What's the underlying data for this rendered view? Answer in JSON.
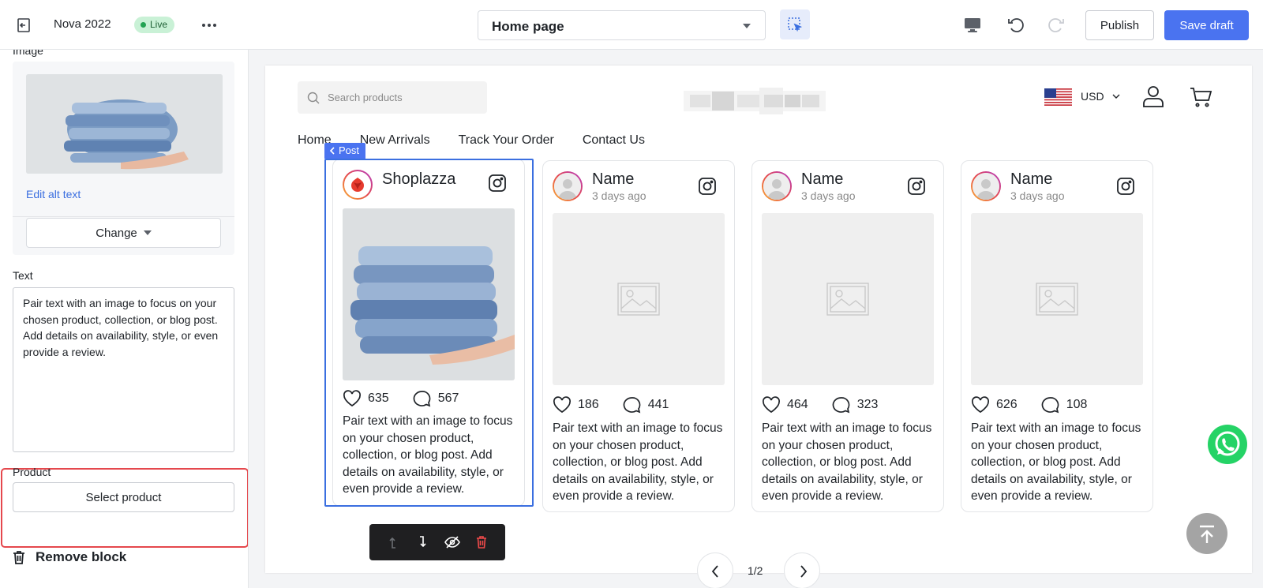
{
  "topbar": {
    "store_name": "Nova 2022",
    "status_badge": "Live",
    "page_select_value": "Home page",
    "publish_label": "Publish",
    "save_label": "Save draft"
  },
  "left_panel": {
    "image_section_label": "Image",
    "edit_alt_text": "Edit alt text",
    "change_label": "Change",
    "text_label": "Text",
    "text_value": "Pair text with an image to focus on your chosen product, collection, or blog post. Add details on availability, style, or even provide a review.",
    "product_label": "Product",
    "select_product_label": "Select product",
    "remove_block_label": "Remove block"
  },
  "storefront": {
    "search_placeholder": "Search products",
    "currency": "USD",
    "nav": [
      "Home",
      "New Arrivals",
      "Track Your Order",
      "Contact Us"
    ],
    "selected_block_tag": "Post",
    "posts": [
      {
        "name": "Shoplazza",
        "date": "",
        "likes": "635",
        "comments": "567",
        "description": "Pair text with an image to focus on your chosen product, collection, or blog post. Add details on availability, style, or even provide a review.",
        "has_image": true
      },
      {
        "name": "Name",
        "date": "3 days ago",
        "likes": "186",
        "comments": "441",
        "description": "Pair text with an image to focus on your chosen product, collection, or blog post. Add details on availability, style, or even provide a review.",
        "has_image": false
      },
      {
        "name": "Name",
        "date": "3 days ago",
        "likes": "464",
        "comments": "323",
        "description": "Pair text with an image to focus on your chosen product, collection, or blog post. Add details on availability, style, or even provide a review.",
        "has_image": false
      },
      {
        "name": "Name",
        "date": "3 days ago",
        "likes": "626",
        "comments": "108",
        "description": "Pair text with an image to focus on your chosen product, collection, or blog post. Add details on availability, style, or even provide a review.",
        "has_image": false
      }
    ],
    "pagination": "1/2"
  },
  "colors": {
    "primary": "#4a73f0",
    "selection_outline": "#3b6fe0",
    "highlight_red": "#e5484d",
    "live_badge_bg": "#c9f1d6",
    "whatsapp": "#25d366"
  },
  "icons": {
    "back": "exit-icon",
    "more": "more-horizontal-icon",
    "inspect": "select-cursor-icon",
    "device": "desktop-icon",
    "undo": "undo-icon",
    "redo": "redo-icon",
    "remove": "trash-icon",
    "search": "search-icon",
    "account": "user-icon",
    "cart": "cart-icon",
    "like": "heart-icon",
    "comment": "comment-icon",
    "instagram": "instagram-icon"
  }
}
